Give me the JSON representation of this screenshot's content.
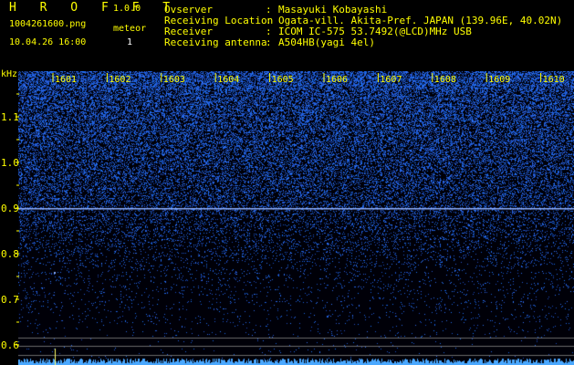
{
  "app": {
    "name": "H R O F F T",
    "version": "1.0.0",
    "filename": "1004261600.png",
    "datetime": "10.04.26 16:00",
    "meteor_label": "meteor",
    "meteor_count": "1"
  },
  "info": {
    "rows": [
      {
        "label": "Ovserver",
        "value": "Masayuki Kobayashi"
      },
      {
        "label": "Receiving Location",
        "value": "Ogata-vill. Akita-Pref. JAPAN (139.96E, 40.02N)"
      },
      {
        "label": "Receiver",
        "value": "ICOM IC-575 53.7492(@LCD)MHz USB"
      },
      {
        "label": "Receiving antenna",
        "value": "A504HB(yagi 4el)"
      }
    ]
  },
  "axis": {
    "unit": "kHz",
    "y_ticks": [
      "1.1",
      "1.0",
      "0.9",
      "0.8",
      "0.7",
      "0.6"
    ],
    "y_values": [
      1.1,
      1.0,
      0.9,
      0.8,
      0.7,
      0.6
    ],
    "time_labels": [
      "1601",
      "1602",
      "1603",
      "1604",
      "1605",
      "1606",
      "1607",
      "1608",
      "1609",
      "1610"
    ]
  },
  "signal": {
    "carrier_khz": 0.9,
    "meteor_count": 1
  },
  "colors": {
    "text_yellow": "#ffff00",
    "text_white": "#ffffff",
    "background": "#000000",
    "noise": "#2b4fff",
    "carrier": "#8fb0ff"
  }
}
